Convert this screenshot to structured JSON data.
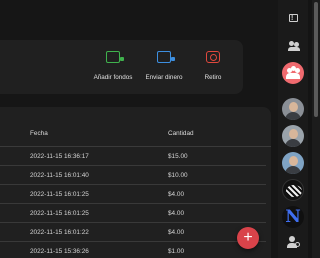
{
  "actions": {
    "add_funds": "Añadir fondos",
    "send_money": "Enviar dinero",
    "withdraw": "Retiro",
    "colors": {
      "add": "#3fb24d",
      "send": "#3d8fe0",
      "withdraw": "#e0483d"
    }
  },
  "table": {
    "headers": {
      "date": "Fecha",
      "amount": "Cantidad"
    },
    "rows": [
      {
        "date": "2022-11-15 16:36:17",
        "amount": "$15.00"
      },
      {
        "date": "2022-11-15 16:01:40",
        "amount": "$10.00"
      },
      {
        "date": "2022-11-15 16:01:25",
        "amount": "$4.00"
      },
      {
        "date": "2022-11-15 16:01:25",
        "amount": "$4.00"
      },
      {
        "date": "2022-11-15 16:01:22",
        "amount": "$4.00"
      },
      {
        "date": "2022-11-15 15:36:26",
        "amount": "$1.00"
      }
    ]
  },
  "fab": {
    "label": "+",
    "color": "#d9434a"
  },
  "sidebar": {
    "icons": [
      "feedback-icon",
      "group-add-icon",
      "community-icon",
      "manage-account-icon"
    ],
    "avatar_letter": "N"
  }
}
